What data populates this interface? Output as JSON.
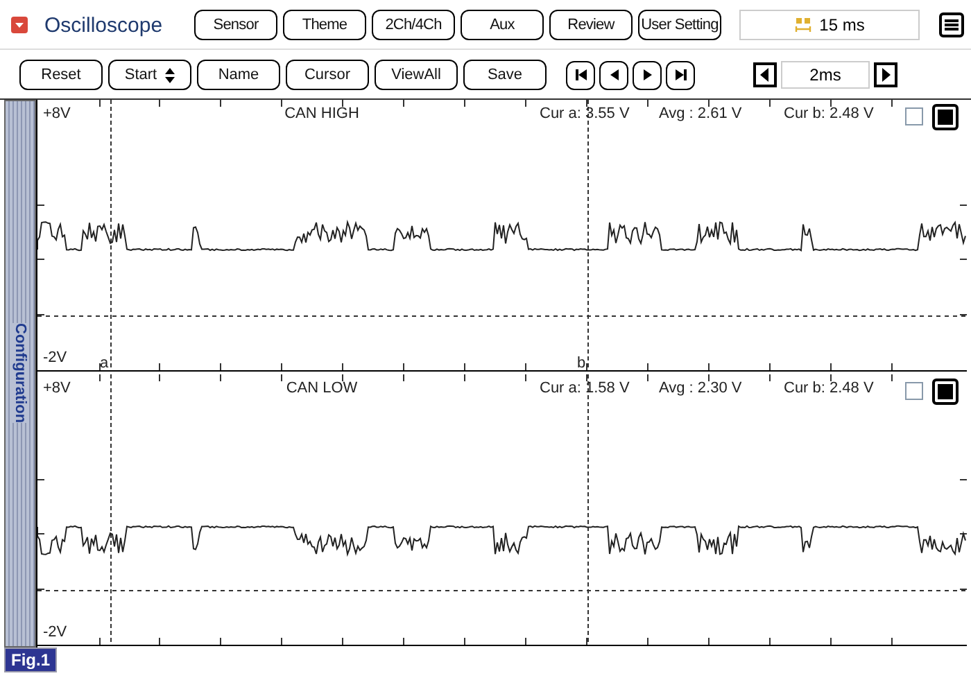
{
  "app": {
    "title": "Oscilloscope"
  },
  "top_buttons": [
    "Sensor",
    "Theme",
    "2Ch/4Ch",
    "Aux",
    "Review",
    "User Setting"
  ],
  "time_display": {
    "value": "15 ms"
  },
  "control_buttons": [
    {
      "label": "Reset",
      "kind": "plain"
    },
    {
      "label": "Start",
      "kind": "spinner"
    },
    {
      "label": "Name",
      "kind": "plain"
    },
    {
      "label": "Cursor",
      "kind": "plain"
    },
    {
      "label": "ViewAll",
      "kind": "plain"
    },
    {
      "label": "Save",
      "kind": "plain"
    }
  ],
  "timebase": {
    "value": "2ms"
  },
  "sidebar": {
    "label": "Configuration"
  },
  "channels": [
    {
      "name": "CAN HIGH",
      "kind": "high",
      "top_label": "+8V",
      "bottom_label": "-2V",
      "readouts": [
        "Cur a: 3.55 V",
        "Avg  : 2.61 V",
        "Cur b: 2.48 V"
      ],
      "checked": false,
      "cursor_labels": [
        "a",
        "b"
      ]
    },
    {
      "name": "CAN LOW",
      "kind": "low",
      "top_label": "+8V",
      "bottom_label": "-2V",
      "readouts": [
        "Cur a: 1.58 V",
        "Avg  : 2.30 V",
        "Cur b: 2.48 V"
      ],
      "checked": false
    }
  ],
  "figure_label": "Fig.1"
}
